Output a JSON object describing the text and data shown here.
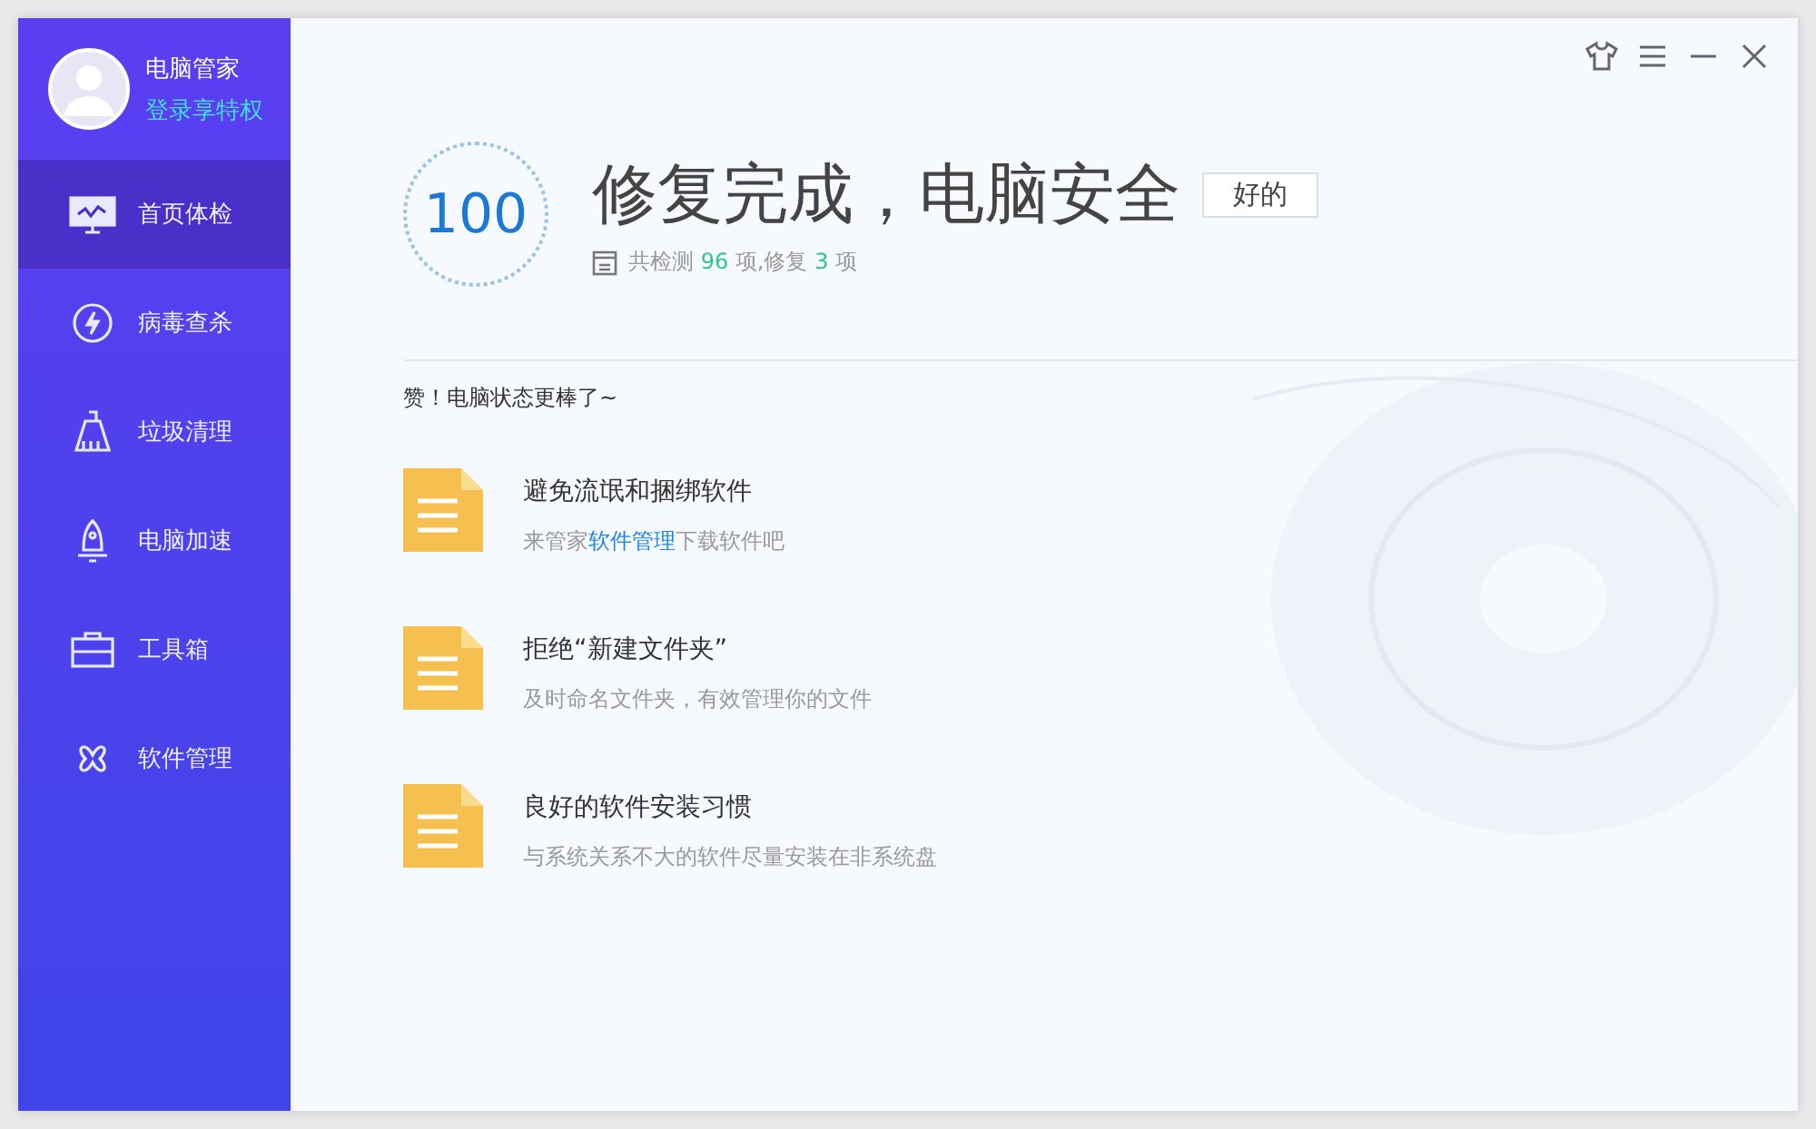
{
  "profile": {
    "name": "电脑管家",
    "login_link": "登录享特权"
  },
  "sidebar": {
    "items": [
      {
        "label": "首页体检",
        "kind": "monitor",
        "selected": true
      },
      {
        "label": "病毒查杀",
        "kind": "bolt",
        "selected": false
      },
      {
        "label": "垃圾清理",
        "kind": "broom",
        "selected": false
      },
      {
        "label": "电脑加速",
        "kind": "rocket",
        "selected": false
      },
      {
        "label": "工具箱",
        "kind": "toolbox",
        "selected": false
      },
      {
        "label": "软件管理",
        "kind": "clover",
        "selected": false
      }
    ]
  },
  "title_bar": {
    "buttons": [
      {
        "kind": "skin"
      },
      {
        "kind": "menu"
      },
      {
        "kind": "minimize"
      },
      {
        "kind": "close"
      }
    ]
  },
  "result": {
    "score": "100",
    "title": "修复完成，电脑安全",
    "ok_button": "好的",
    "summary": [
      {
        "text": "共检测 ",
        "kind": "plain"
      },
      {
        "text": "96",
        "kind": "count"
      },
      {
        "text": " 项,修复 ",
        "kind": "plain"
      },
      {
        "text": "3",
        "kind": "count"
      },
      {
        "text": " 项",
        "kind": "plain"
      }
    ]
  },
  "message": "赞！电脑状态更棒了~",
  "tips": [
    {
      "title": "避免流氓和捆绑软件",
      "description": [
        {
          "text": "来管家",
          "kind": "plain"
        },
        {
          "text": "软件管理",
          "kind": "link"
        },
        {
          "text": "下载软件吧",
          "kind": "plain"
        }
      ]
    },
    {
      "title": "拒绝“新建文件夹”",
      "description": [
        {
          "text": "及时命名文件夹，有效管理你的文件",
          "kind": "plain"
        }
      ]
    },
    {
      "title": "良好的软件安装习惯",
      "description": [
        {
          "text": "与系统关系不大的软件尽量安装在非系统盘",
          "kind": "plain"
        }
      ]
    }
  ]
}
